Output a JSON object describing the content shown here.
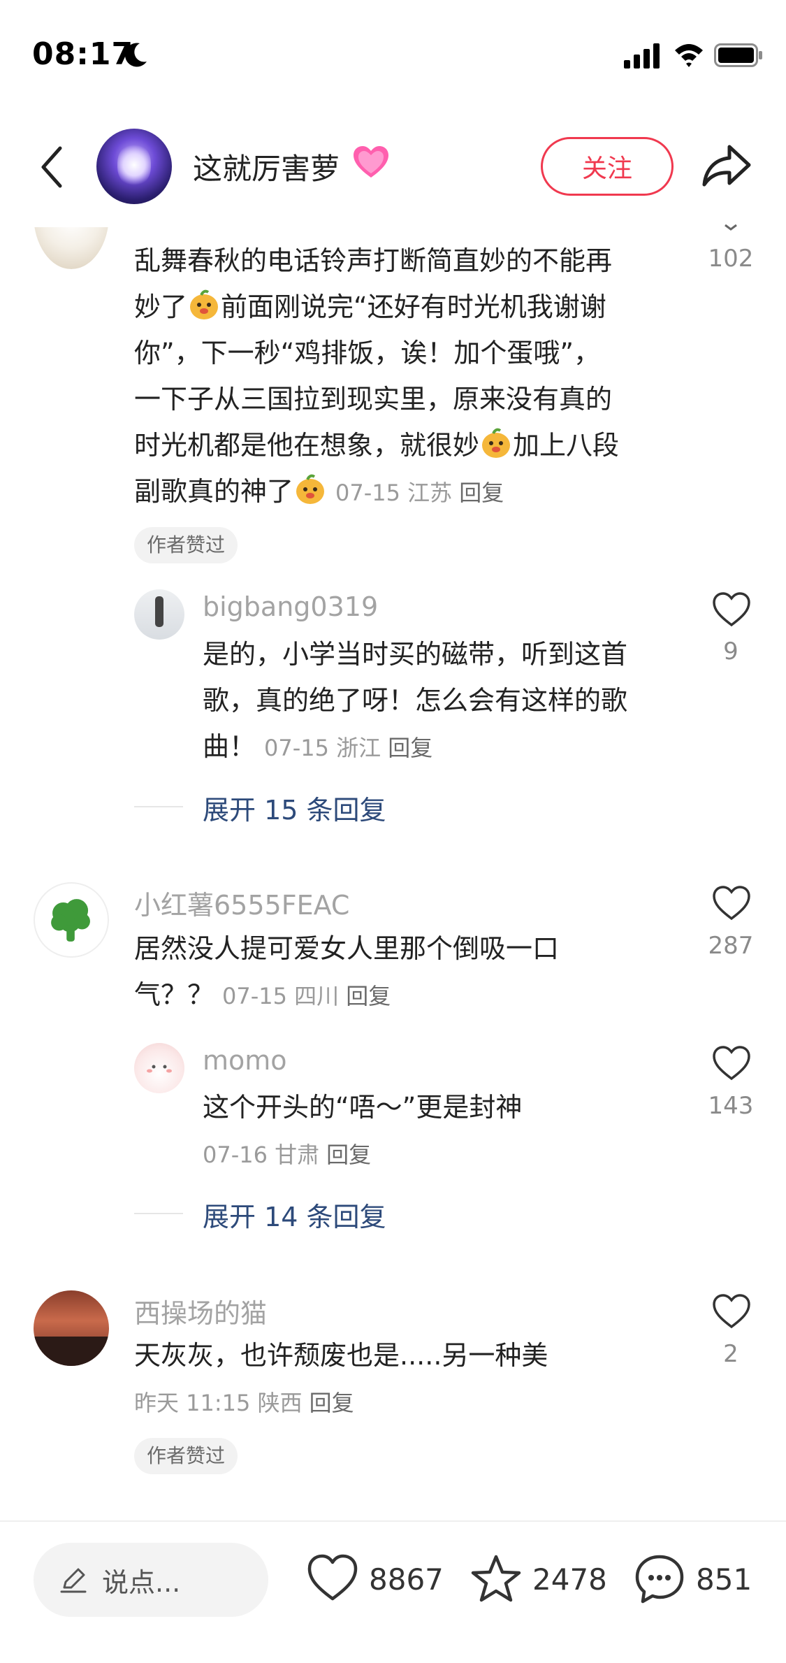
{
  "status_bar": {
    "time": "08:17"
  },
  "header": {
    "author_name": "这就厉害萝",
    "follow_label": "关注"
  },
  "comments": [
    {
      "text": "乱舞春秋的电话铃声打断简直妙的不能再妙了[emoji]前面刚说完“还好有时光机我谢谢你”，下一秒“鸡排饭，诶！加个蛋哦”，一下子从三国拉到现实里，原来没有真的时光机都是他在想象，就很妙[emoji]加上八段副歌真的神了[emoji]",
      "line1": "乱舞春秋的电话铃声打断简直妙的不能再",
      "line2a": "妙了",
      "line2b": "前面刚说完“还好有时光机我谢谢",
      "line3": "你”，下一秒“鸡排饭，诶！加个蛋哦”，",
      "line4": "一下子从三国拉到现实里，原来没有真的",
      "line5a": "时光机都是他在想象，就很妙",
      "line5b": "加上八段",
      "line6": "副歌真的神了",
      "date": "07-15",
      "location": "江苏",
      "reply": "回复",
      "tag": "作者赞过",
      "likes": "102",
      "sub_reply": {
        "username": "bigbang0319",
        "line1": "是的，小学当时买的磁带，听到这首",
        "line2": "歌，真的绝了呀！怎么会有这样的歌",
        "line3": "曲！",
        "date": "07-15",
        "location": "浙江",
        "reply": "回复",
        "likes": "9"
      },
      "expand_label": "展开 15 条回复"
    },
    {
      "username": "小红薯6555FEAC",
      "line1": "居然没人提可爱女人里那个倒吸一口",
      "line2": "气？？",
      "date": "07-15",
      "location": "四川",
      "reply": "回复",
      "likes": "287",
      "sub_reply": {
        "username": "momo",
        "line1": "这个开头的“唔～”更是封神",
        "date": "07-16",
        "location": "甘肃",
        "reply": "回复",
        "likes": "143"
      },
      "expand_label": "展开 14 条回复"
    },
    {
      "username": "西操场的猫",
      "line1": "天灰灰，也许颓废也是.....另一种美",
      "date": "昨天 11:15",
      "location": "陕西",
      "reply": "回复",
      "tag": "作者赞过",
      "likes": "2"
    }
  ],
  "bottom_bar": {
    "input_placeholder": "说点...",
    "likes": "8867",
    "collects": "2478",
    "comments": "851"
  },
  "colors": {
    "accent": "#f0394f",
    "link": "#2d4a7a",
    "meta": "#9a9a9a"
  }
}
